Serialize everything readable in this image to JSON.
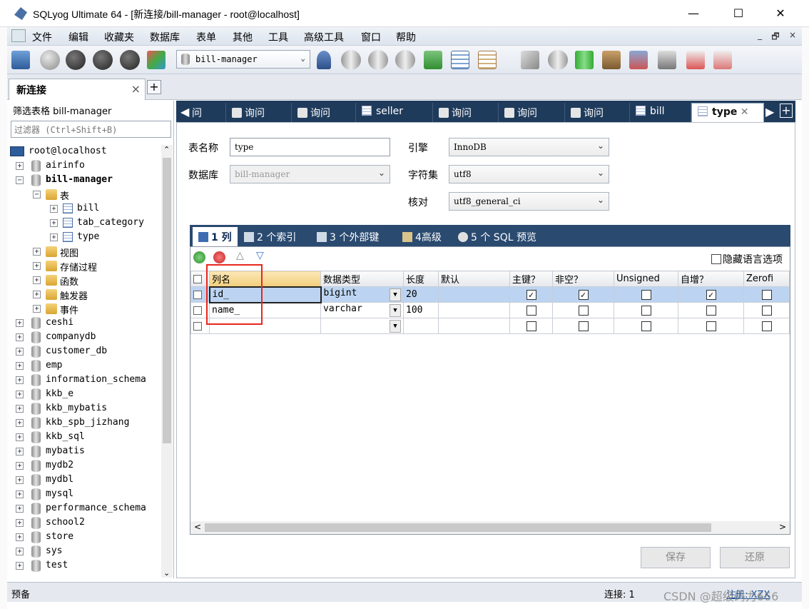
{
  "window": {
    "title": "SQLyog Ultimate 64 - [新连接/bill-manager - root@localhost]",
    "minimize": "—",
    "maximize": "☐",
    "close": "✕"
  },
  "menu": [
    "文件",
    "编辑",
    "收藏夹",
    "数据库",
    "表单",
    "其他",
    "工具",
    "高级工具",
    "窗口",
    "帮助"
  ],
  "mdi_controls": [
    "_",
    "🗗",
    "×"
  ],
  "toolbar": {
    "db_select": "bill-manager"
  },
  "connection_tab": {
    "label": "新连接",
    "close": "×",
    "add": "+"
  },
  "sidebar": {
    "filter_label": "筛选表格 bill-manager",
    "filter_placeholder": "过滤器 (Ctrl+Shift+B)",
    "tree": [
      {
        "label": "root@localhost",
        "type": "server",
        "level": 0,
        "exp": ""
      },
      {
        "label": "airinfo",
        "type": "db",
        "level": 1,
        "exp": "+"
      },
      {
        "label": "bill-manager",
        "type": "db",
        "level": 1,
        "exp": "−",
        "bold": true
      },
      {
        "label": "表",
        "type": "folder",
        "level": 2,
        "exp": "−"
      },
      {
        "label": "bill",
        "type": "table",
        "level": 3,
        "exp": "+"
      },
      {
        "label": "tab_category",
        "type": "table",
        "level": 3,
        "exp": "+"
      },
      {
        "label": "type",
        "type": "table",
        "level": 3,
        "exp": "+"
      },
      {
        "label": "视图",
        "type": "folder",
        "level": 2,
        "exp": "+"
      },
      {
        "label": "存储过程",
        "type": "folder",
        "level": 2,
        "exp": "+"
      },
      {
        "label": "函数",
        "type": "folder",
        "level": 2,
        "exp": "+"
      },
      {
        "label": "触发器",
        "type": "folder",
        "level": 2,
        "exp": "+"
      },
      {
        "label": "事件",
        "type": "folder",
        "level": 2,
        "exp": "+"
      },
      {
        "label": "ceshi",
        "type": "db",
        "level": 1,
        "exp": "+"
      },
      {
        "label": "companydb",
        "type": "db",
        "level": 1,
        "exp": "+"
      },
      {
        "label": "customer_db",
        "type": "db",
        "level": 1,
        "exp": "+"
      },
      {
        "label": "emp",
        "type": "db",
        "level": 1,
        "exp": "+"
      },
      {
        "label": "information_schema",
        "type": "db",
        "level": 1,
        "exp": "+"
      },
      {
        "label": "kkb_e",
        "type": "db",
        "level": 1,
        "exp": "+"
      },
      {
        "label": "kkb_mybatis",
        "type": "db",
        "level": 1,
        "exp": "+"
      },
      {
        "label": "kkb_spb_jizhang",
        "type": "db",
        "level": 1,
        "exp": "+"
      },
      {
        "label": "kkb_sql",
        "type": "db",
        "level": 1,
        "exp": "+"
      },
      {
        "label": "mybatis",
        "type": "db",
        "level": 1,
        "exp": "+"
      },
      {
        "label": "mydb2",
        "type": "db",
        "level": 1,
        "exp": "+"
      },
      {
        "label": "mydbl",
        "type": "db",
        "level": 1,
        "exp": "+"
      },
      {
        "label": "mysql",
        "type": "db",
        "level": 1,
        "exp": "+"
      },
      {
        "label": "performance_schema",
        "type": "db",
        "level": 1,
        "exp": "+"
      },
      {
        "label": "school2",
        "type": "db",
        "level": 1,
        "exp": "+"
      },
      {
        "label": "store",
        "type": "db",
        "level": 1,
        "exp": "+"
      },
      {
        "label": "sys",
        "type": "db",
        "level": 1,
        "exp": "+"
      },
      {
        "label": "test",
        "type": "db",
        "level": 1,
        "exp": "+"
      }
    ]
  },
  "query_tabs": [
    {
      "label": "问",
      "kind": "query"
    },
    {
      "label": "询问",
      "kind": "query"
    },
    {
      "label": "询问",
      "kind": "query"
    },
    {
      "label": "seller",
      "kind": "table"
    },
    {
      "label": "询问",
      "kind": "query"
    },
    {
      "label": "询问",
      "kind": "query"
    },
    {
      "label": "询问",
      "kind": "query"
    },
    {
      "label": "bill",
      "kind": "table"
    },
    {
      "label": "type",
      "kind": "table",
      "active": true,
      "close": "✕"
    }
  ],
  "form": {
    "table_name_label": "表名称",
    "table_name": "type",
    "database_label": "数据库",
    "database": "bill-manager",
    "engine_label": "引擎",
    "engine": "InnoDB",
    "charset_label": "字符集",
    "charset": "utf8",
    "collation_label": "核对",
    "collation": "utf8_general_ci"
  },
  "subtabs": [
    "1 列",
    "2 个索引",
    "3 个外部键",
    "4高级",
    "5 个 SQL 预览"
  ],
  "grid": {
    "hide_lang_label": "隐藏语言选项",
    "headers": [
      "列名",
      "数据类型",
      "长度",
      "默认",
      "主键？",
      "非空？",
      "Unsigned",
      "自增？",
      "Zerofi"
    ],
    "rows": [
      {
        "name": "id_",
        "type": "bigint",
        "length": "20",
        "default": "",
        "pk": true,
        "notnull": true,
        "unsigned": false,
        "autoinc": true,
        "zerofill": false
      },
      {
        "name": "name_",
        "type": "varchar",
        "length": "100",
        "default": "",
        "pk": false,
        "notnull": false,
        "unsigned": false,
        "autoinc": false,
        "zerofill": false
      },
      {
        "name": "",
        "type": "",
        "length": "",
        "default": "",
        "pk": false,
        "notnull": false,
        "unsigned": false,
        "autoinc": false,
        "zerofill": false
      }
    ]
  },
  "actions": {
    "save": "保存",
    "revert": "还原"
  },
  "status": {
    "left": "预备",
    "connections": "连接: 1",
    "register": "注册: XZX"
  },
  "watermark": "CSDN @超级码力666"
}
